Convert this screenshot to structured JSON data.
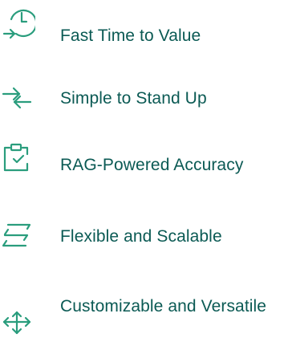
{
  "colors": {
    "icon": "#2a9d7d",
    "text": "#0b5a54",
    "background": "#ffffff"
  },
  "features": [
    {
      "icon": "clock-icon",
      "label": "Fast Time to Value"
    },
    {
      "icon": "crossed-arrows-icon",
      "label": "Simple to Stand Up"
    },
    {
      "icon": "clipboard-check-icon",
      "label": "RAG-Powered Accuracy"
    },
    {
      "icon": "stacked-layers-icon",
      "label": "Flexible and Scalable"
    },
    {
      "icon": "move-arrows-icon",
      "label": "Customizable and Versatile"
    }
  ]
}
